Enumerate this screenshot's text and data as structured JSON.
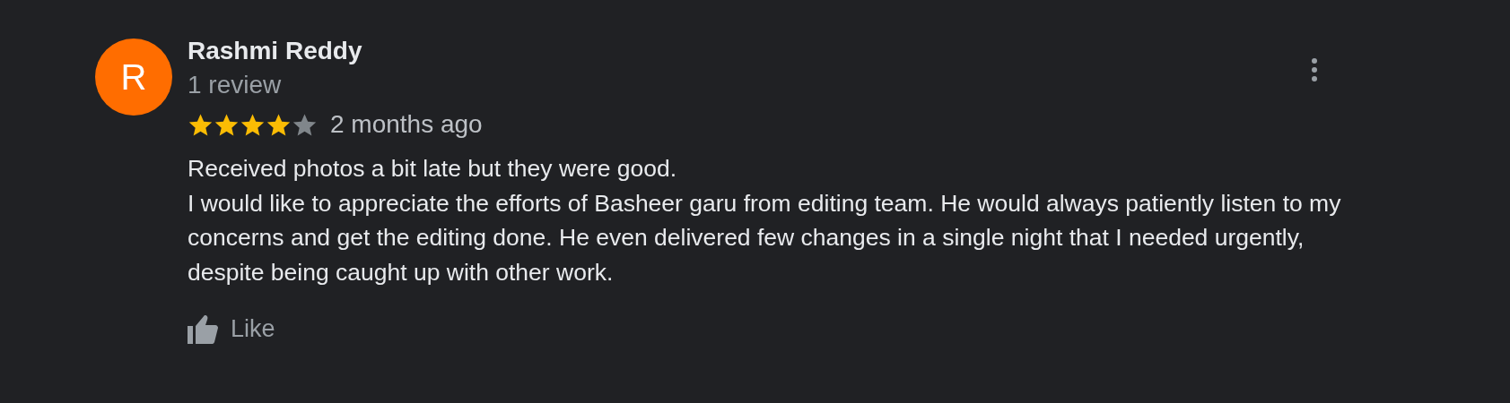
{
  "review": {
    "avatar_letter": "R",
    "author": "Rashmi Reddy",
    "review_count": "1 review",
    "stars": 4,
    "time": "2 months ago",
    "paragraphs": [
      "Received photos a bit late but they were good.",
      "I would like to appreciate the efforts of Basheer garu from editing team. He would always patiently listen to my concerns and get the editing done. He even delivered few changes in a single night that I needed urgently, despite being caught up with other work."
    ],
    "like_label": "Like"
  }
}
